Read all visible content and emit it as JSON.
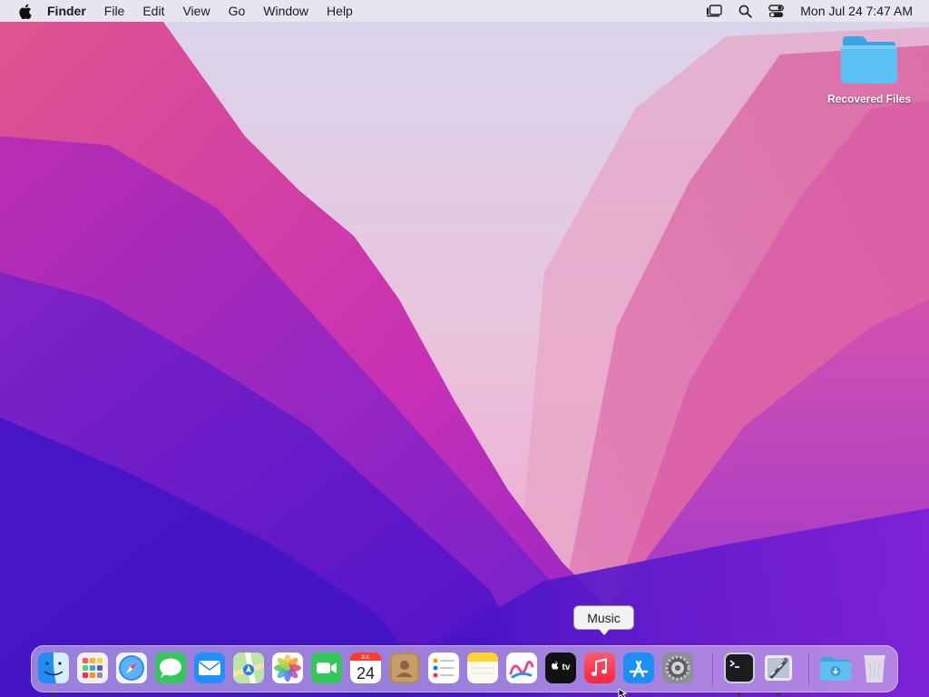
{
  "menubar": {
    "app_name": "Finder",
    "menus": [
      "File",
      "Edit",
      "View",
      "Go",
      "Window",
      "Help"
    ],
    "status_icons": [
      "stage-manager-icon",
      "search-icon",
      "control-center-icon"
    ],
    "clock": "Mon Jul 24  7:47 AM"
  },
  "desktop": {
    "items": [
      {
        "label": "Recovered Files",
        "icon": "folder-icon",
        "color": "#4cb8f0"
      }
    ]
  },
  "tooltip": {
    "label": "Music"
  },
  "dock": {
    "items": [
      {
        "name": "Finder",
        "icon": "finder-icon",
        "running": true
      },
      {
        "name": "Launchpad",
        "icon": "launchpad-icon",
        "running": false
      },
      {
        "name": "Safari",
        "icon": "safari-icon",
        "running": false
      },
      {
        "name": "Messages",
        "icon": "messages-icon",
        "running": false
      },
      {
        "name": "Mail",
        "icon": "mail-icon",
        "running": false
      },
      {
        "name": "Maps",
        "icon": "maps-icon",
        "running": false
      },
      {
        "name": "Photos",
        "icon": "photos-icon",
        "running": false
      },
      {
        "name": "FaceTime",
        "icon": "facetime-icon",
        "running": false
      },
      {
        "name": "Calendar",
        "icon": "calendar-icon",
        "running": false,
        "month": "JUL",
        "day": "24"
      },
      {
        "name": "Contacts",
        "icon": "contacts-icon",
        "running": false
      },
      {
        "name": "Reminders",
        "icon": "reminders-icon",
        "running": false
      },
      {
        "name": "Notes",
        "icon": "notes-icon",
        "running": false
      },
      {
        "name": "Freeform",
        "icon": "freeform-icon",
        "running": false
      },
      {
        "name": "TV",
        "icon": "tv-icon",
        "running": false,
        "text": "tv"
      },
      {
        "name": "Music",
        "icon": "music-icon",
        "running": false
      },
      {
        "name": "App Store",
        "icon": "app-store-icon",
        "running": false
      },
      {
        "name": "System Settings",
        "icon": "settings-icon",
        "running": false
      },
      {
        "name": "Terminal",
        "icon": "terminal-icon",
        "running": true
      },
      {
        "name": "Script Editor",
        "icon": "script-editor-icon",
        "running": true
      },
      {
        "name": "Downloads",
        "icon": "downloads-folder-icon",
        "running": false
      },
      {
        "name": "Trash",
        "icon": "trash-icon",
        "running": false
      }
    ]
  }
}
